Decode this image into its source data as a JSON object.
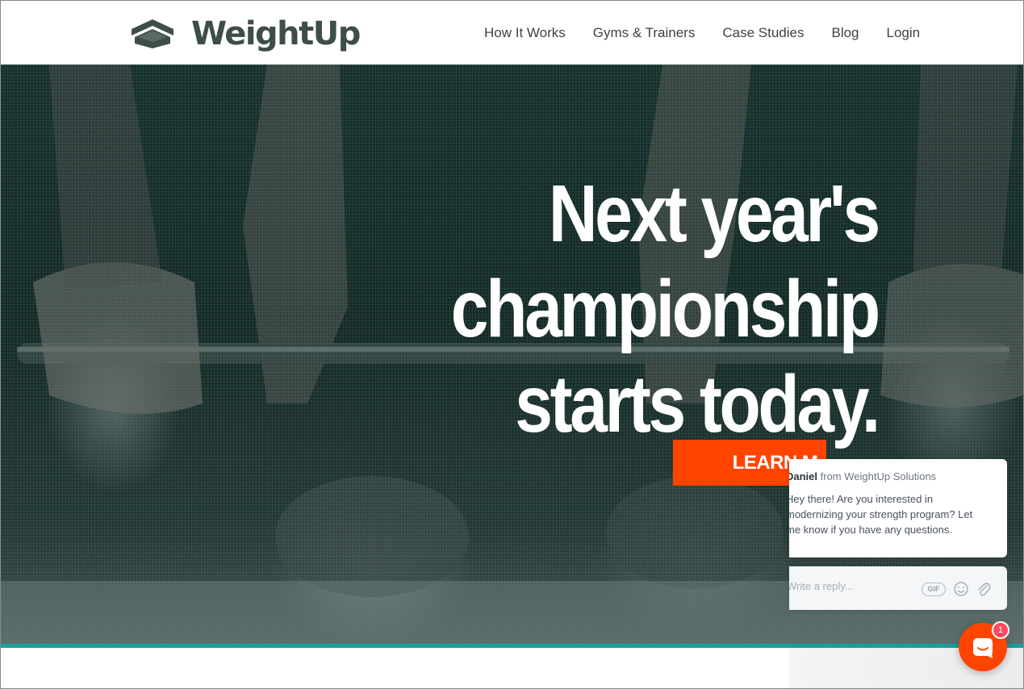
{
  "header": {
    "logo_text": "WeightUp",
    "nav": [
      {
        "label": "How It Works"
      },
      {
        "label": "Gyms & Trainers"
      },
      {
        "label": "Case Studies"
      },
      {
        "label": "Blog"
      },
      {
        "label": "Login"
      }
    ]
  },
  "hero": {
    "headline_lines": [
      "Next year's",
      "championship",
      "starts today."
    ],
    "cta_label": "LEARN M"
  },
  "chat": {
    "sender_name": "Daniel",
    "sender_org": "from WeightUp Solutions",
    "message": "Hey there! Are you interested in modernizing your strength program? Let me know if you have any questions.",
    "reply_placeholder": "Write a reply...",
    "gif_label": "GIF",
    "unread_count": "1"
  },
  "colors": {
    "accent": "#ff4400",
    "teal": "#1a9e9a",
    "logo": "#3f4d4a"
  },
  "icons": {
    "logo": "logo-mark-icon",
    "emoji": "emoji-icon",
    "attach": "paperclip-icon",
    "launcher": "chat-bubble-icon"
  }
}
